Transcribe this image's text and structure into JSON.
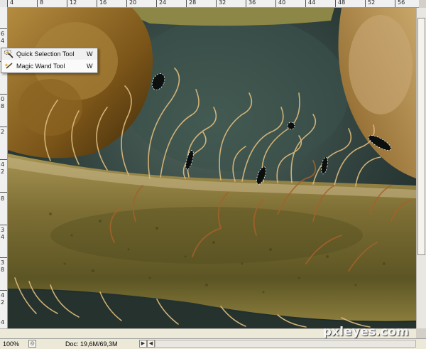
{
  "rulers": {
    "top_labels": [
      "4",
      "8",
      "12",
      "16",
      "20",
      "24",
      "28",
      "32",
      "36",
      "40",
      "44",
      "48",
      "52",
      "56"
    ],
    "left_labels": [
      "6",
      "4",
      "0",
      "8",
      "2",
      "4",
      "2",
      "8",
      "3",
      "4",
      "3",
      "8",
      "4",
      "2",
      "4"
    ]
  },
  "tool_menu": {
    "items": [
      {
        "label": "Quick Selection Tool",
        "shortcut": "W",
        "icon": "quick-selection-icon"
      },
      {
        "label": "Magic Wand Tool",
        "shortcut": "W",
        "icon": "magic-wand-icon"
      }
    ]
  },
  "status": {
    "zoom": "100%",
    "doc": "Doc: 19,6M/69,3M"
  },
  "watermark": "pxleyes.com",
  "colors": {
    "selection_highlight": "#eeeeee",
    "canvas_background": "#2c3b3b",
    "stem": "#7a6a2e"
  }
}
